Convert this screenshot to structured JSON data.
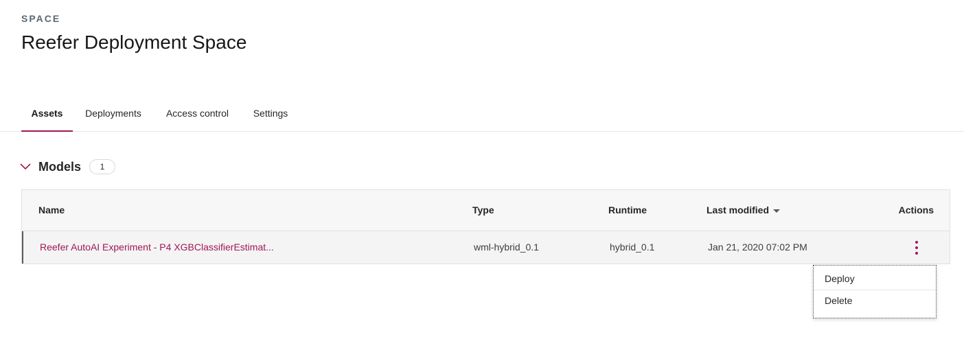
{
  "header": {
    "eyebrow": "SPACE",
    "title": "Reefer Deployment Space"
  },
  "tabs": [
    {
      "label": "Assets",
      "active": true
    },
    {
      "label": "Deployments",
      "active": false
    },
    {
      "label": "Access control",
      "active": false
    },
    {
      "label": "Settings",
      "active": false
    }
  ],
  "section": {
    "title": "Models",
    "count": "1",
    "expanded": true
  },
  "table": {
    "columns": [
      "Name",
      "Type",
      "Runtime",
      "Last modified",
      "Actions"
    ],
    "sort": {
      "column": "Last modified",
      "direction": "descending"
    },
    "rows": [
      {
        "name": "Reefer AutoAI Experiment - P4 XGBClassifierEstimat...",
        "type": "wml-hybrid_0.1",
        "runtime": "hybrid_0.1",
        "last_modified": "Jan 21, 2020 07:02 PM"
      }
    ]
  },
  "actions_menu": {
    "items": [
      "Deploy",
      "Delete"
    ]
  },
  "colors": {
    "accent": "#9f1853",
    "eyebrow": "#5a6872"
  },
  "icons": {
    "section_toggle": "chevron-down-icon",
    "row_actions": "overflow-menu-vertical-icon",
    "sort_indicator": "caret-down-icon"
  }
}
